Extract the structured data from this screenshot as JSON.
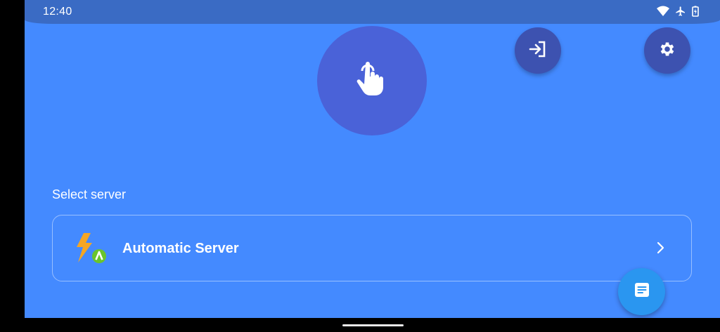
{
  "status_bar": {
    "time": "12:40",
    "icons": [
      "wifi-icon",
      "airplane-mode-icon",
      "battery-charging-icon"
    ]
  },
  "connect": {
    "icon": "tap-hand-icon"
  },
  "top_actions": {
    "login_icon": "login-arrow-icon",
    "settings_icon": "gear-icon"
  },
  "server_section": {
    "label": "Select server",
    "selected_server": {
      "name": "Automatic Server",
      "icon": "lightning-auto-icon"
    }
  },
  "log_fab": {
    "icon": "document-notes-icon"
  },
  "colors": {
    "background": "#448aff",
    "status_bar": "#3a6bc4",
    "connect_circle": "#4a62d8",
    "action_fab": "#3d52b0",
    "log_fab": "#2a96f0"
  }
}
